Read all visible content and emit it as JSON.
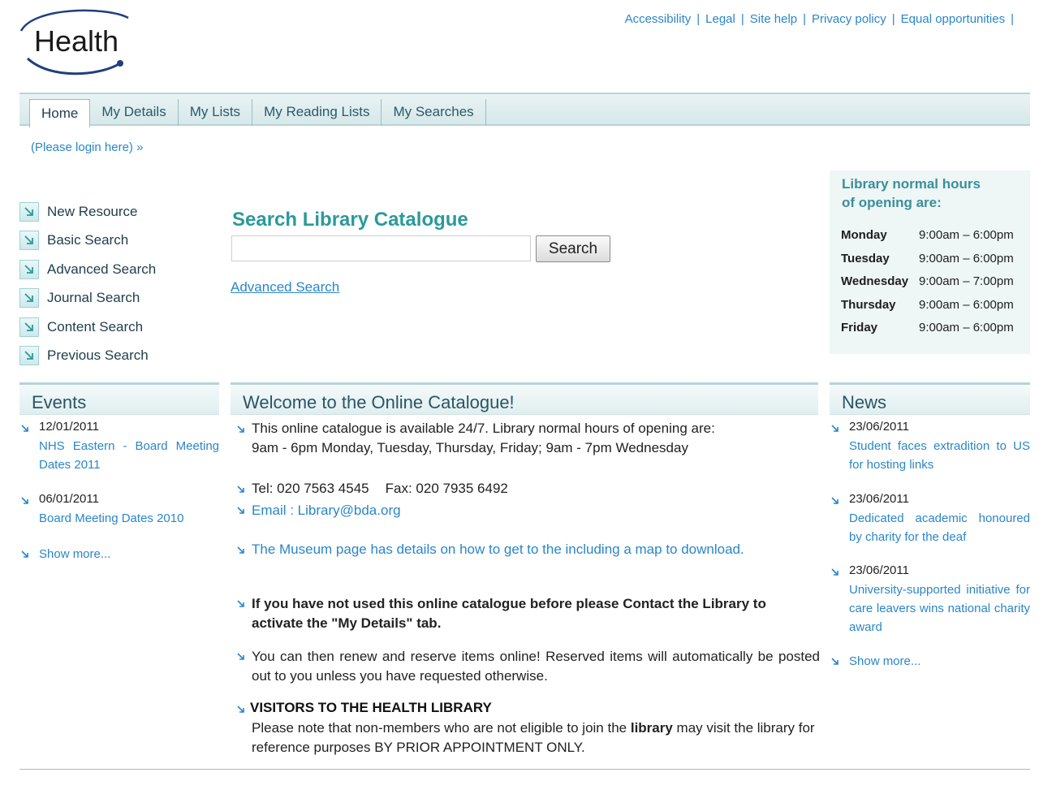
{
  "logo": {
    "text": "Health"
  },
  "util_links": [
    "Accessibility",
    "Legal",
    "Site help",
    "Privacy policy",
    "Equal opportunities"
  ],
  "util_separator": "|",
  "nav": {
    "tabs": [
      "Home",
      "My Details",
      "My Lists",
      "My Reading Lists",
      "My Searches"
    ],
    "active": "Home"
  },
  "login_link": "(Please login here) »",
  "search_menu": [
    "New Resource",
    "Basic Search",
    "Advanced Search",
    "Journal Search",
    "Content Search",
    "Previous Search"
  ],
  "search": {
    "title": "Search Library Catalogue",
    "input_value": "",
    "button_label": "Search",
    "advanced_link": "Advanced Search"
  },
  "hours": {
    "title_line1": "Library normal hours",
    "title_line2": "of opening are:",
    "rows": [
      {
        "day": "Monday",
        "time": "9:00am – 6:00pm"
      },
      {
        "day": "Tuesday",
        "time": "9:00am – 6:00pm"
      },
      {
        "day": "Wednesday",
        "time": "9:00am – 7:00pm"
      },
      {
        "day": "Thursday",
        "time": "9:00am – 6:00pm"
      },
      {
        "day": "Friday",
        "time": "9:00am – 6:00pm"
      }
    ]
  },
  "events": {
    "header": "Events",
    "items": [
      {
        "date": "12/01/2011",
        "title": "NHS Eastern - Board Meeting Dates 2011"
      },
      {
        "date": "06/01/2011",
        "title": "Board Meeting Dates 2010"
      }
    ],
    "show_more": "Show more..."
  },
  "welcome": {
    "header": "Welcome to the Online Catalogue!",
    "para1_line1": "This online catalogue is available 24/7. Library normal hours of opening are:",
    "para1_line2": "9am - 6pm Monday, Tuesday, Thursday, Friday; 9am - 7pm Wednesday",
    "tel": "Tel: 020 7563 4545",
    "fax": "Fax: 020 7935 6492",
    "email": "Email : Library@bda.org",
    "museum": "The Museum page has details on how to get to the including a map to download.",
    "contact": "If you have not used this online catalogue before please Contact the Library to activate the \"My Details\" tab.",
    "renew": "You can then renew and reserve items online! Reserved items will automatically be posted out to you unless you have requested otherwise.",
    "visitors_title": "VISITORS TO THE HEALTH LIBRARY",
    "visitors_text_1": "Please note that non-members who are not eligible to join the ",
    "visitors_text_bold": "library",
    "visitors_text_2": "  may visit the library for reference purposes BY PRIOR APPOINTMENT ONLY."
  },
  "news": {
    "header": "News",
    "items": [
      {
        "date": "23/06/2011",
        "title": "Student faces extradition to US for hosting links"
      },
      {
        "date": "23/06/2011",
        "title": "Dedicated academic honoured by charity for the deaf"
      },
      {
        "date": "23/06/2011",
        "title": "University-supported initiative for care leavers wins national charity award"
      }
    ],
    "show_more": "Show more..."
  },
  "colors": {
    "accent": "#2a9a9a",
    "link": "#2a86c9",
    "nav_bg": "#d6e8ea"
  },
  "icons": {
    "menu_arrow": "arrow-down-right-icon",
    "bullet": "bullet-arrow-icon"
  }
}
